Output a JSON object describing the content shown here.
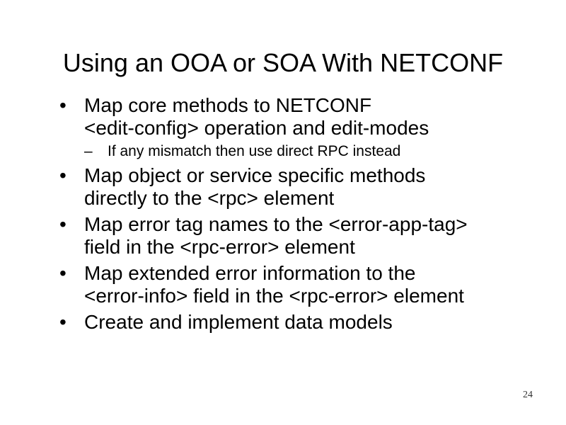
{
  "slide": {
    "title": "Using an OOA or SOA With NETCONF",
    "bullet_marker": "•",
    "sub_marker": "–",
    "bullets": [
      {
        "lines": [
          "Map core methods to NETCONF",
          "<edit-config> operation and edit-modes"
        ],
        "sub": "If any mismatch then use direct RPC instead"
      },
      {
        "lines": [
          "Map object or service specific methods",
          "directly to the <rpc> element"
        ]
      },
      {
        "lines": [
          "Map error tag names to the <error-app-tag>",
          "field in the <rpc-error> element"
        ]
      },
      {
        "lines": [
          "Map extended error information to the",
          "<error-info> field in the <rpc-error> element"
        ]
      },
      {
        "lines": [
          "Create and implement data models"
        ]
      }
    ],
    "page_number": "24"
  }
}
